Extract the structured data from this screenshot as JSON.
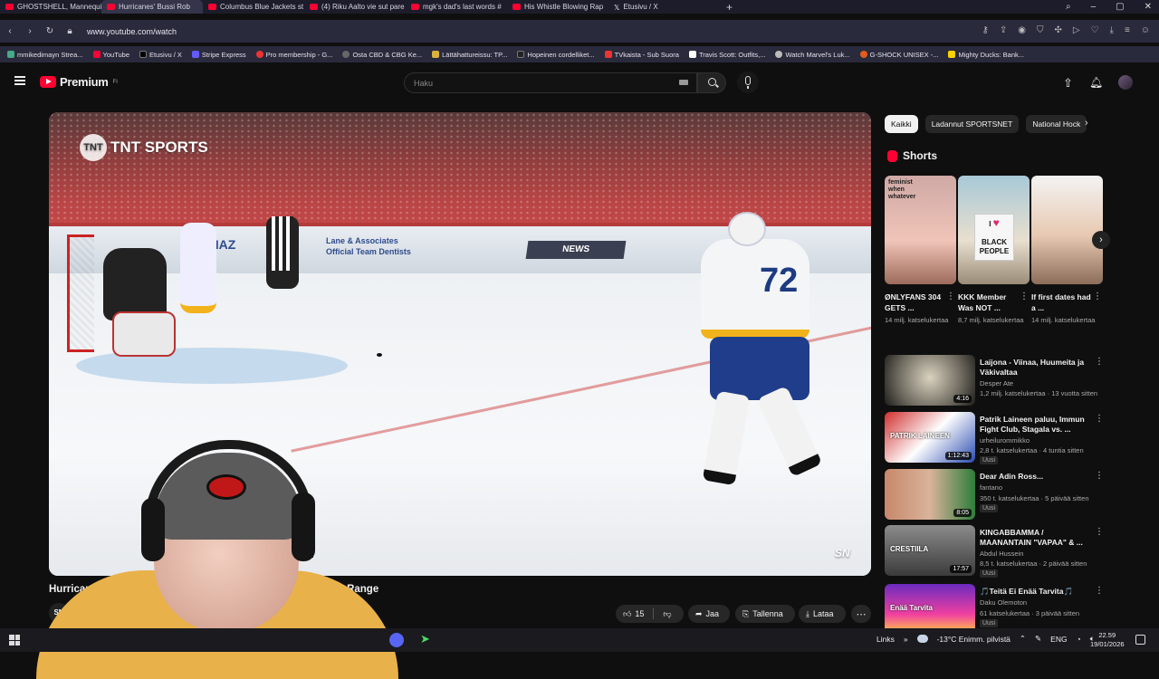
{
  "browser": {
    "tabs": [
      {
        "label": "GHOSTSHELL, Mannequin"
      },
      {
        "label": "Hurricanes' Bussi Rob",
        "active": true
      },
      {
        "label": "Columbus Blue Jackets st"
      },
      {
        "label": "(4) Riku Aalto vie sut pare"
      },
      {
        "label": "mgk's dad's last words #"
      },
      {
        "label": "His Whistle Blowing Rap"
      },
      {
        "label": "Etusivu / X"
      }
    ],
    "url": "www.youtube.com/watch",
    "bookmarks": [
      "mmikedimayn Strea...",
      "YouTube",
      "Etusivu / X",
      "Stripe Express",
      "Pro membership - G...",
      "Osta CBD & CBG Ke...",
      "Lättähattureissu: TP...",
      "Hopeinen cordelliket...",
      "TVkaista - Sub Suora",
      "Travis Scott: Outfits,...",
      "Watch Marvel's Luk...",
      "G-SHOCK UNISEX -...",
      "Mighty Ducks: Bank..."
    ]
  },
  "youtube": {
    "logo_text": "Premium",
    "logo_sup": "FI",
    "search_placeholder": "Haku",
    "video": {
      "title_start": "Hurrican",
      "title_end": "Point-Blank Range",
      "broadcaster": "TNT SPORTS",
      "watermark": "SN",
      "channel_avatar_text": "SN"
    },
    "actions": {
      "likes": "15",
      "share": "Jaa",
      "save": "Tallenna",
      "download": "Lataa"
    },
    "chips": [
      "Kaikki",
      "Ladannut SPORTSNET",
      "National Hock"
    ],
    "shorts_title": "Shorts",
    "shorts": [
      {
        "title": "ØNLYFANS 304 GETS ...",
        "views": "14 milj. katselukertaa",
        "caption": "feminist when whatever"
      },
      {
        "title": "KKK Member Was NOT ...",
        "views": "8,7 milj. katselukertaa",
        "sign": "I ♥ BLACK PEOPLE"
      },
      {
        "title": "If first dates had a ...",
        "views": "14 milj. katselukertaa"
      }
    ],
    "recommendations": [
      {
        "title": "Laijona - Viinaa, Huumeita ja Väkivaltaa",
        "channel": "Desper Ate",
        "meta": "1,2 milj. katselukertaa · 13 vuotta sitten",
        "duration": "4:16",
        "badge": ""
      },
      {
        "title": "Patrik Laineen paluu, Immun Fight Club, Stagala vs. ...",
        "channel": "urheilurommikko",
        "meta": "2,8 t. katselukertaa · 4 tuntia sitten",
        "duration": "1:12:43",
        "badge": "Uusi",
        "thumb_text": "PATRIK LAINEEN"
      },
      {
        "title": "Dear Adin Ross...",
        "channel": "fantano",
        "meta": "350 t. katselukertaa · 5 päivää sitten",
        "duration": "8:05",
        "badge": "Uusi"
      },
      {
        "title": "KINGABBAMMA / MAANANTAIN \"VAPAA\" & ...",
        "channel": "Abdul Hussein",
        "meta": "8,5 t. katselukertaa · 2 päivää sitten",
        "duration": "17:57",
        "badge": "Uusi",
        "thumb_text": "CRESTIILA"
      },
      {
        "title": "🎵Teitä Ei Enää Tarvita🎵",
        "channel": "Daku Olemoton",
        "meta": "61 katselukertaa · 3 päivää sitten",
        "duration": "",
        "badge": "Uusi",
        "thumb_text": "Enää Tarvita"
      }
    ]
  },
  "taskbar": {
    "links": "Links",
    "weather": "-13°C  Enimm. pilvistä",
    "lang": "ENG",
    "time": "22.59",
    "date": "19/01/2026"
  },
  "colors": {
    "yt_red": "#ff0033",
    "background": "#0f0f0f",
    "chip_bg": "#272727"
  }
}
